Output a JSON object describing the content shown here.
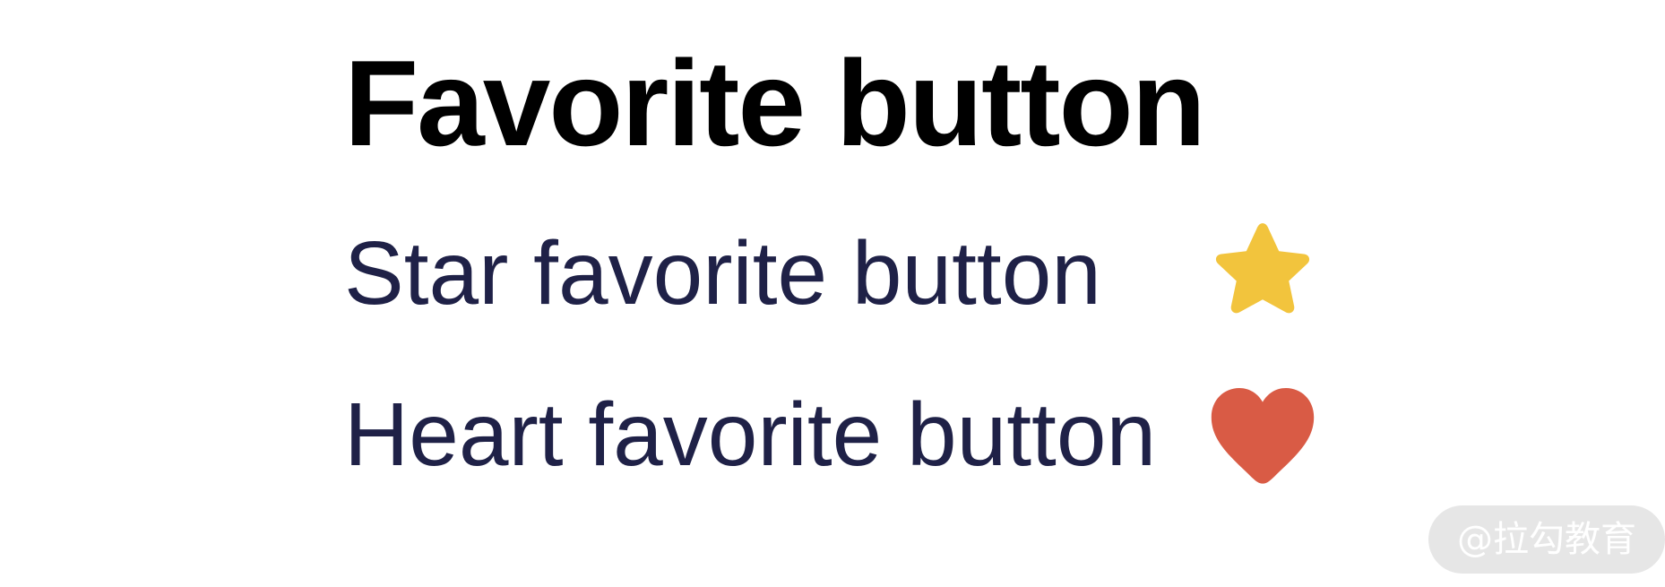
{
  "page": {
    "title": "Favorite button"
  },
  "rows": [
    {
      "label": "Star favorite button",
      "icon": "star-icon",
      "color": "#F2C43D"
    },
    {
      "label": "Heart favorite button",
      "icon": "heart-icon",
      "color": "#D95B45"
    }
  ],
  "colors": {
    "title": "#000000",
    "label": "#1F2147",
    "background": "#FFFFFF"
  },
  "watermark": {
    "text": "@拉勾教育"
  }
}
